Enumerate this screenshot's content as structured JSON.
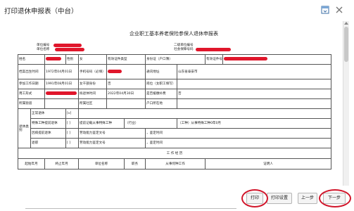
{
  "window": {
    "title": "打印退休申报表（中台）",
    "maximize_icon": "maximize-icon",
    "close_icon": "close-icon"
  },
  "document": {
    "title": "企业职工基本养老保险参保人退休申报表",
    "header_left_1": "单位编号",
    "header_left_2": "单位名称",
    "header_right_1": "二级单位编号",
    "header_right_2": "社会保障号码",
    "rows": {
      "name_label": "姓名",
      "gender_label": "性别",
      "gender_value": "女",
      "id_type_label": "有效证件类型",
      "id_type_value": "身份证（户口簿）",
      "id_no_label": "有效证件号码",
      "birth_label": "档案出生时间",
      "birth_value": "1972年04月01日",
      "phone_label": "手机号码（必填）",
      "addr_label": "通讯地址",
      "addr_value": "山东省泰安市",
      "work_start_label": "参加工作日期",
      "work_start_value": "1991年08月01日",
      "female_cadre_label": "女干部身份",
      "female_cadre_value": "否",
      "post_label": "岗位（女职工填写）",
      "employment_label": "用工形式",
      "retire_time_label": "拟退休时间",
      "retire_time_value": "2022年04月30日",
      "delay_label": "是否缓缴补费",
      "delay_value": "否",
      "street_label": "所属街道",
      "community_label": "所属社区",
      "hukou_label": "户口所在地",
      "retire_category_label": "退休类别",
      "normal_retire": "正常退休",
      "normal_retire_check": "[v]",
      "special_type_label": "特殊工种提前退休",
      "special_type_check": "[ ]",
      "special_type_text": "提前记载从事特殊工种",
      "industry_text": "（行业）",
      "type_text": "（工种）从事特殊工种0年0月",
      "illness_label": "因病提前退休",
      "illness_check": "[ ]",
      "illness_text": "劳动能力鉴定文号",
      "illness_time": "，鉴定时间",
      "retire_label": "退职",
      "retire_check": "[ ]",
      "retire_text": "劳动能力鉴定文号",
      "retire_time_text": "，鉴定时间",
      "work_history": "工 作 经 历",
      "col1": "起始年月",
      "col2": "终止年月",
      "col3": "单位名称",
      "col4": "职务",
      "col5": "从事何种工作",
      "col6": "证明人"
    }
  },
  "buttons": {
    "print": "打印",
    "print_settings": "打印设置",
    "prev": "上一步",
    "next": "下一步"
  },
  "colors": {
    "redaction": "#e0162b",
    "highlight_ring": "#d1152a"
  }
}
